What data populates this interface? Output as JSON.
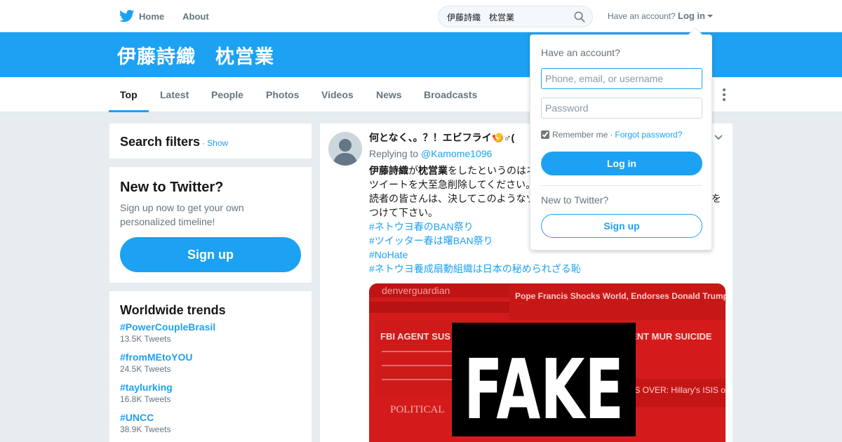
{
  "nav": {
    "home_label": "Home",
    "about_label": "About",
    "search_value": "伊藤詩織　枕営業",
    "have_account": "Have an account?",
    "login_label": "Log in"
  },
  "banner": {
    "title": "伊藤詩織　枕営業"
  },
  "tabs": [
    {
      "label": "Top"
    },
    {
      "label": "Latest"
    },
    {
      "label": "People"
    },
    {
      "label": "Photos"
    },
    {
      "label": "Videos"
    },
    {
      "label": "News"
    },
    {
      "label": "Broadcasts"
    }
  ],
  "filters": {
    "title": "Search filters",
    "dot": "·",
    "show": "Show"
  },
  "signup_card": {
    "title": "New to Twitter?",
    "text": "Sign up now to get your own personalized timeline!",
    "button": "Sign up"
  },
  "trends": {
    "title": "Worldwide trends",
    "items": [
      {
        "name": "#PowerCoupleBrasil",
        "count": "13.5K Tweets"
      },
      {
        "name": "#fromMEtoYOU",
        "count": "24.5K Tweets"
      },
      {
        "name": "#taylurking",
        "count": "16.8K Tweets"
      },
      {
        "name": "#UNCC",
        "count": "38.9K Tweets"
      }
    ]
  },
  "tweet": {
    "header": "何となく、。？！エビフライ🍤♂(",
    "replying_prefix": "Replying to",
    "replying_handle": "@Kamome1096",
    "body_bold1": "伊藤詩織",
    "body_mid": "が",
    "body_bold2": "枕営業",
    "body_rest1": "をしたというのはネ",
    "body_line2": "ツイートを大至急削除してください。",
    "body_line3a": "読者の皆さんは、決してこのようなツ",
    "body_line3b": "を",
    "body_line4": "つけて下さい。",
    "hashtags": [
      "#ネトウヨ春のBAN祭り",
      "#ツイッター春は曙BAN祭り",
      "#NoHate",
      "#ネトウヨ養成扇動組織は日本の秘められざる恥"
    ],
    "media": {
      "site_name": "denverguardian",
      "headline_top": "Pope Francis Shocks World, Endorses Donald Trump for President, Releases Statement",
      "headline_left": "FBI AGENT SUS IN HILLARY EM LEAKS FOUND D APPARENT MUR SUICIDE",
      "logo": "POLITICAL",
      "overlay": "FAKE",
      "headline_right": "'S OVER: Hillary's ISIS orse Than Anyone C"
    }
  },
  "dropdown": {
    "title": "Have an account?",
    "username_placeholder": "Phone, email, or username",
    "password_placeholder": "Password",
    "remember": "Remember me",
    "separator": "·",
    "forgot": "Forgot password?",
    "login_button": "Log in",
    "new_to_twitter": "New to Twitter?",
    "signup_button": "Sign up"
  },
  "colors": {
    "brand_blue": "#1da1f2",
    "background": "#e6ecf0",
    "media_red": "#d31b1b"
  }
}
